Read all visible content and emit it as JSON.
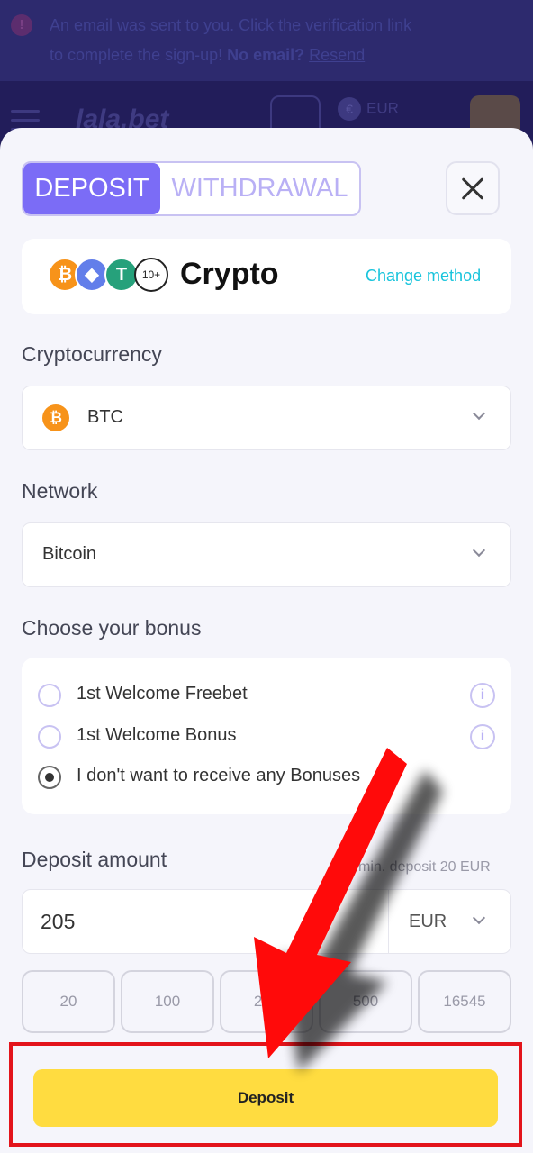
{
  "notice": {
    "line1": "An email was sent to you. Click the verification link",
    "line2_start": "to complete the sign-up! ",
    "no_email": "No email?",
    "resend": "Resend"
  },
  "app": {
    "logo": "lala.bet",
    "currency": "EUR",
    "currency_symbol": "€"
  },
  "modal": {
    "tabs": {
      "deposit": "DEPOSIT",
      "withdrawal": "WITHDRAWAL"
    },
    "method": {
      "title": "Crypto",
      "more_badge": "10+",
      "change_label": "Change method",
      "icons": [
        "bitcoin-icon",
        "ethereum-icon",
        "tether-icon"
      ]
    },
    "crypto": {
      "label": "Cryptocurrency",
      "value": "BTC"
    },
    "network": {
      "label": "Network",
      "value": "Bitcoin"
    },
    "bonus": {
      "label": "Choose your bonus",
      "options": [
        {
          "label": "1st Welcome Freebet",
          "selected": false
        },
        {
          "label": "1st Welcome Bonus",
          "selected": false
        },
        {
          "label": "I don't want to receive any Bonuses",
          "selected": true
        }
      ]
    },
    "amount": {
      "label": "Deposit amount",
      "min_text": "min. deposit 20 EUR",
      "value": "205",
      "currency": "EUR",
      "quick": [
        "20",
        "100",
        "250",
        "500",
        "16545"
      ]
    },
    "deposit_button": "Deposit"
  },
  "colors": {
    "accent": "#7b6cf6",
    "deposit": "#ffdc40",
    "highlight": "#e3141b",
    "link": "#18c4dc"
  }
}
